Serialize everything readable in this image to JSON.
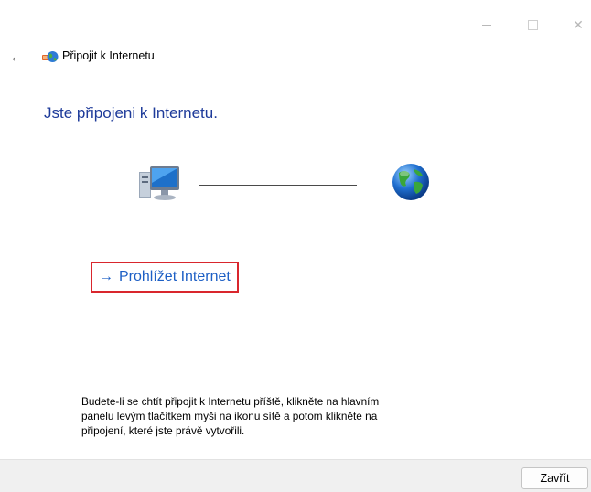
{
  "window": {
    "minimize_icon": "minimize-icon",
    "maximize_icon": "maximize-icon",
    "close_glyph": "✕"
  },
  "titlebar": {
    "back_glyph": "←",
    "title": "Připojit k Internetu"
  },
  "main": {
    "heading": "Jste připojeni k Internetu.",
    "browse_arrow": "→",
    "browse_link": "Prohlížet Internet",
    "info_lines": [
      "Budete-li se chtít připojit k Internetu příště, klikněte na hlavním",
      "panelu levým tlačítkem myši na ikonu sítě a potom klikněte na",
      "připojení, které jste právě vytvořili."
    ]
  },
  "footer": {
    "close_label": "Zavřít"
  },
  "colors": {
    "heading": "#1e3b9a",
    "link": "#1d5fc5",
    "highlight_border": "#d9262d",
    "footer_bg": "#f0f0f0"
  }
}
